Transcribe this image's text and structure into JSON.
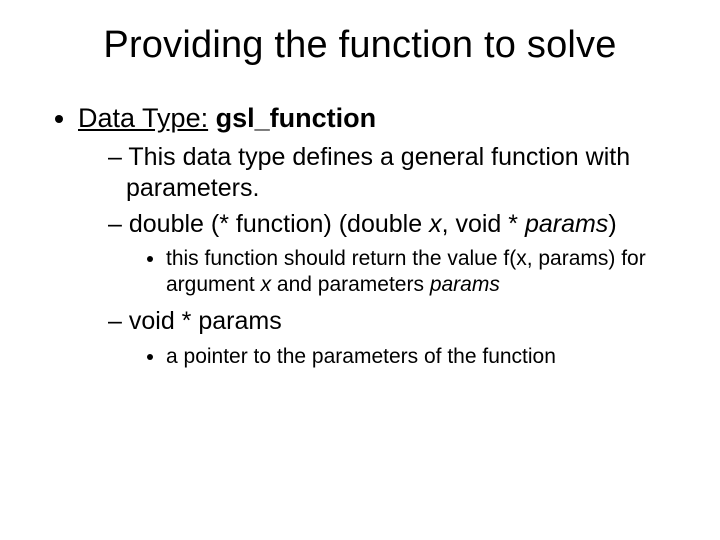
{
  "title": "Providing the function to solve",
  "bullet1": {
    "label": "Data Type:",
    "value": "gsl_function",
    "sub": {
      "s1": "This data type defines a general function with parameters.",
      "s2_a": "double (* function) (double ",
      "s2_x": "x",
      "s2_b": ", void * ",
      "s2_params": "params",
      "s2_c": ")",
      "s2_note_a": "this function should return the value f(x, params) for argument ",
      "s2_note_x": "x",
      "s2_note_b": " and parameters ",
      "s2_note_params": "params",
      "s3": "void * params",
      "s3_note": "a pointer to the parameters of the function"
    }
  }
}
